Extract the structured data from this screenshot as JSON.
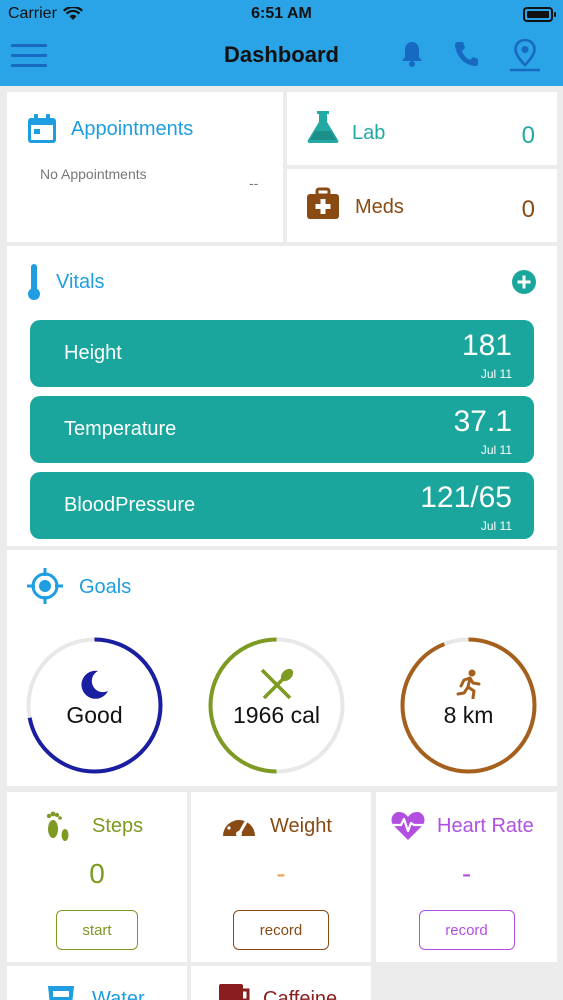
{
  "status": {
    "carrier": "Carrier",
    "time": "6:51 AM"
  },
  "nav": {
    "title": "Dashboard"
  },
  "appointments": {
    "title": "Appointments",
    "empty": "No Appointments",
    "dash": "--"
  },
  "lab": {
    "label": "Lab",
    "count": "0"
  },
  "meds": {
    "label": "Meds",
    "count": "0"
  },
  "vitals": {
    "title": "Vitals",
    "items": [
      {
        "name": "Height",
        "value": "181",
        "date": "Jul 11"
      },
      {
        "name": "Temperature",
        "value": "37.1",
        "date": "Jul 11"
      },
      {
        "name": "BloodPressure",
        "value": "121/65",
        "date": "Jul 11"
      }
    ]
  },
  "goals": {
    "title": "Goals",
    "items": [
      {
        "label": "Good",
        "progress": 0.72,
        "color": "#1a1ea0"
      },
      {
        "label": "1966 cal",
        "progress": 0.5,
        "color": "#7d9a22"
      },
      {
        "label": "8 km",
        "progress": 0.94,
        "color": "#a4601c"
      }
    ]
  },
  "tiles": [
    {
      "name": "Steps",
      "value": "0",
      "button": "start",
      "color": "#7d9a22"
    },
    {
      "name": "Weight",
      "value": "-",
      "button": "record",
      "color": "#8a4a13",
      "value_color": "#f0a24a"
    },
    {
      "name": "Heart Rate",
      "value": "-",
      "button": "record",
      "color": "#b34fe0"
    }
  ],
  "tiles2": [
    {
      "name": "Water",
      "color": "#1e9ee0"
    },
    {
      "name": "Caffeine",
      "color": "#8a1e1e"
    }
  ]
}
